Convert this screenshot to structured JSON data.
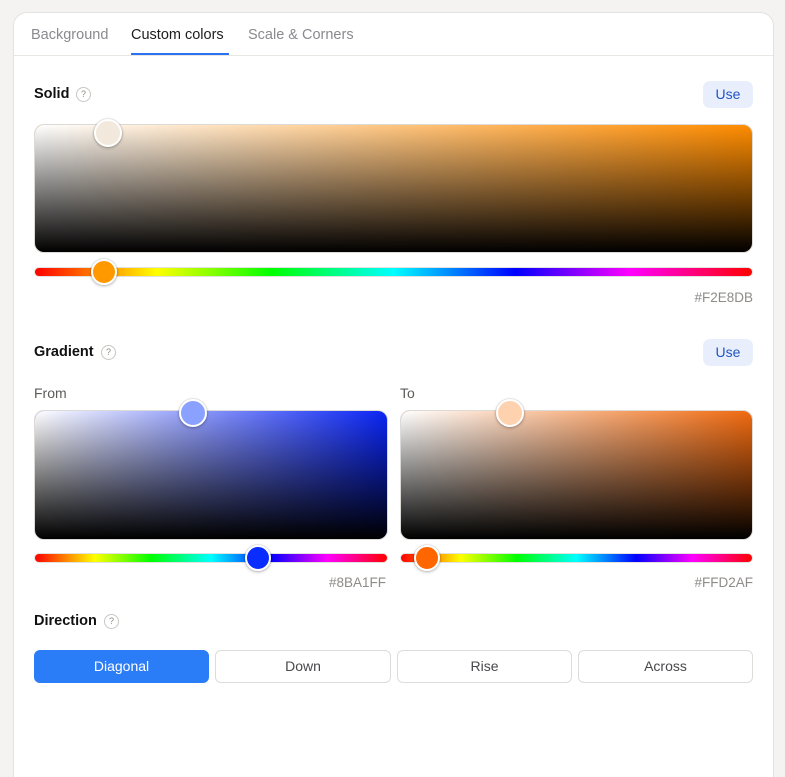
{
  "tabs": [
    {
      "label": "Background"
    },
    {
      "label": "Custom colors"
    },
    {
      "label": "Scale & Corners"
    }
  ],
  "active_tab": "Custom colors",
  "solid": {
    "title": "Solid",
    "help_icon": "?",
    "use_label": "Use",
    "hue_base": "#ff8c00",
    "selected_color": "#F2E8DB",
    "hex": "#F2E8DB",
    "hue_knob_color": "#ff9900"
  },
  "gradient": {
    "title": "Gradient",
    "help_icon": "?",
    "use_label": "Use",
    "from": {
      "label": "From",
      "hue_base": "#0a25f5",
      "selected_color": "#8BA1FF",
      "hex": "#8BA1FF",
      "hue_knob_color": "#0a2dff"
    },
    "to": {
      "label": "To",
      "hue_base": "#f06a10",
      "selected_color": "#FFD2AF",
      "hex": "#FFD2AF",
      "hue_knob_color": "#ff6600"
    }
  },
  "direction": {
    "title": "Direction",
    "help_icon": "?",
    "options": [
      "Diagonal",
      "Down",
      "Rise",
      "Across"
    ],
    "selected": "Diagonal"
  },
  "colors": {
    "accent": "#2b7cf7",
    "tab_underline": "#2a72f0",
    "use_button_bg": "#e8eefb"
  }
}
